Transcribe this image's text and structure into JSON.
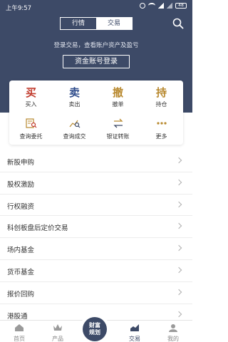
{
  "status_bar": {
    "time": "上午9:57",
    "battery": "48"
  },
  "header": {
    "tabs": [
      {
        "label": "行情",
        "active": false
      },
      {
        "label": "交易",
        "active": true
      }
    ],
    "login_hint": "登录交易，查看账户资产及盈亏",
    "login_button": "资金账号登录"
  },
  "trade_grid": {
    "primary": [
      {
        "char": "买",
        "label": "买入",
        "color": "#c0392b"
      },
      {
        "char": "卖",
        "label": "卖出",
        "color": "#2c4a8a"
      },
      {
        "char": "撤",
        "label": "撤单",
        "color": "#b8892f"
      },
      {
        "char": "持",
        "label": "持仓",
        "color": "#b8892f"
      }
    ],
    "secondary": [
      {
        "label": "查询委托",
        "icon": "search-list-icon"
      },
      {
        "label": "查询成交",
        "icon": "chart-search-icon"
      },
      {
        "label": "银证转账",
        "icon": "transfer-icon"
      },
      {
        "label": "更多",
        "icon": "more-dots-icon"
      }
    ]
  },
  "menu": [
    "新股申购",
    "股权激励",
    "行权融资",
    "科创板盘后定价交易",
    "场内基金",
    "货币基金",
    "报价回购",
    "港股通"
  ],
  "tabbar": {
    "tabs": [
      {
        "label": "首页",
        "icon": "home-icon"
      },
      {
        "label": "产品",
        "icon": "crown-icon"
      },
      {
        "label": "交易",
        "icon": "trade-chart-icon",
        "active": true
      },
      {
        "label": "我的",
        "icon": "user-icon"
      }
    ],
    "center": {
      "line1": "财富",
      "line2": "规划"
    }
  },
  "colors": {
    "header_bg": "#3d4a67",
    "accent_red": "#c0392b",
    "accent_blue": "#2c4a8a",
    "accent_gold": "#b8892f"
  }
}
